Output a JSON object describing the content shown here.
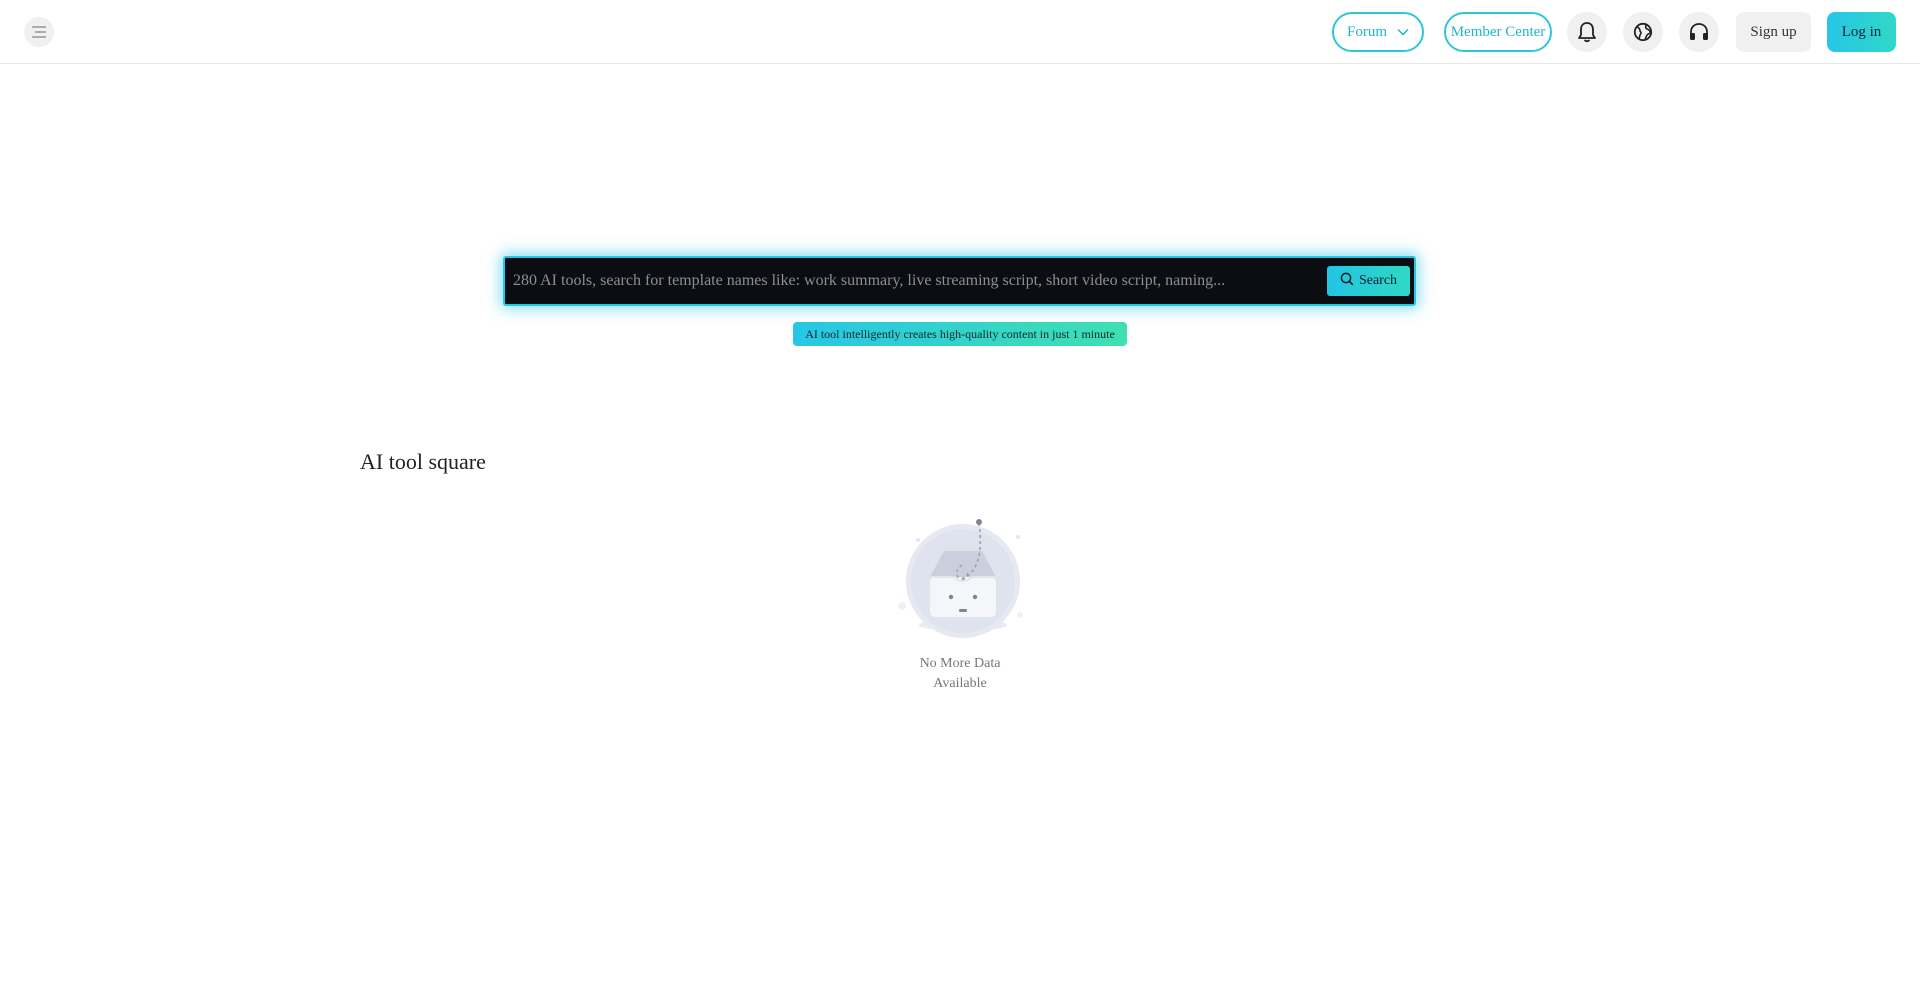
{
  "header": {
    "menu_icon": "hamburger-menu-icon",
    "forum_label": "Forum",
    "member_center_label": "Member Center",
    "notifications_icon": "bell-icon",
    "language_icon": "globe-icon",
    "support_icon": "headset-icon",
    "signup_label": "Sign up",
    "login_label": "Log in"
  },
  "search": {
    "placeholder": "280 AI tools, search for template names like: work summary, live streaming script, short video script, naming...",
    "value": "",
    "button_label": "Search",
    "tagline": "AI tool intelligently creates high-quality content in just 1 minute"
  },
  "main": {
    "section_title": "AI tool square",
    "empty_line1": "No More Data",
    "empty_line2": "Available"
  },
  "colors": {
    "accent": "#27c6e6",
    "accent_green": "#2fd8c4",
    "search_bg": "#0b0d12"
  }
}
